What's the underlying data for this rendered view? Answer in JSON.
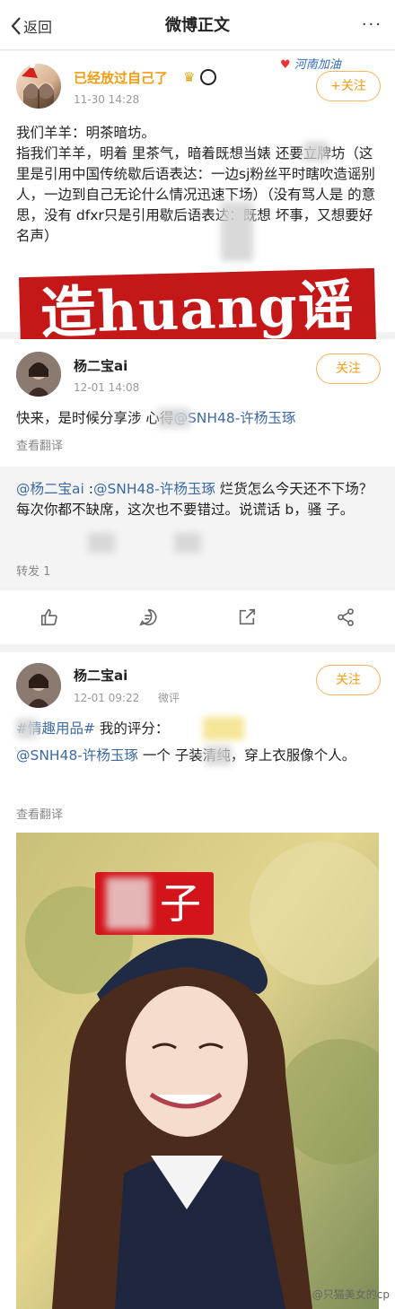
{
  "topbar": {
    "back_label": "返回",
    "title": "微博正文",
    "more_label": "···"
  },
  "post1": {
    "username": "已经放过自己了",
    "time": "11-30 14:28",
    "follow_label": "+关注",
    "badge_text": "河南加油",
    "line1": "我们羊羊：明茶暗坊。",
    "body": "指我们羊羊，明着  里茶气，暗着既想当婊 还要立牌坊（这里是引用中国传统歇后语表达：一边sj粉丝平时瞎吹造谣别人，一边到自己无论什么情况迅速下场）（没有骂人是 的意思，没有 dfxr只是引用歇后语表达：既想 坏事，又想要好名声）",
    "overlay_text": "造huang谣"
  },
  "post2": {
    "username": "杨二宝ai",
    "time": "12-01 14:08",
    "follow_label": "关注",
    "body_text": "快来，是时候分享涉 心得",
    "mention": "@SNH48-许杨玉琢",
    "translate": "查看翻译"
  },
  "repost": {
    "mention1": "@杨二宝ai",
    "sep": " :",
    "mention2": "@SNH48-许杨玉琢",
    "body": " 烂货怎么今天还不下场？每次你都不缺席，这次也不要错过。说谎话  b，骚  子。",
    "repost_count": "转发 1"
  },
  "post3": {
    "username": "杨二宝ai",
    "time": "12-01 09:22",
    "source": "微评",
    "follow_label": "关注",
    "hashtag": "#情趣用品#",
    "rating_text": " 我的评分：",
    "mention": "@SNH48-许杨玉琢",
    "body": " 一个 子装清纯，穿上衣服像个人。",
    "translate": "查看翻译",
    "photo_label": "子"
  },
  "watermark": "@只猫美女的cp"
}
